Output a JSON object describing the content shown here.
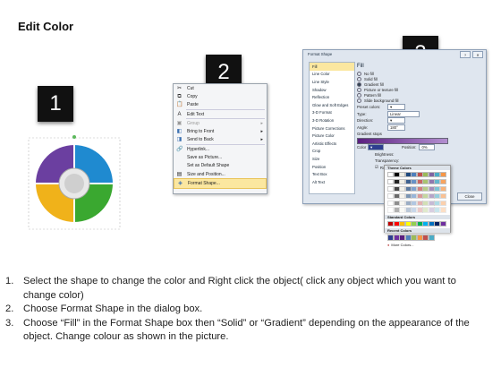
{
  "page": {
    "title": "Edit Color"
  },
  "badges": [
    "1",
    "2",
    "3"
  ],
  "context_menu": {
    "items": [
      {
        "icon": "cut-icon",
        "label": "Cut"
      },
      {
        "icon": "copy-icon",
        "label": "Copy"
      },
      {
        "icon": "paste-icon",
        "label": "Paste"
      },
      {
        "icon": "edit-text-icon",
        "label": "Edit Text"
      },
      {
        "icon": "group-icon",
        "label": "Group",
        "disabled": true,
        "submenu": true
      },
      {
        "icon": "bring-front-icon",
        "label": "Bring to Front",
        "submenu": true
      },
      {
        "icon": "send-back-icon",
        "label": "Send to Back",
        "submenu": true
      },
      {
        "icon": "hyperlink-icon",
        "label": "Hyperlink..."
      },
      {
        "icon": "save-picture-icon",
        "label": "Save as Picture..."
      },
      {
        "icon": "",
        "label": "Set as Default Shape"
      },
      {
        "icon": "size-position-icon",
        "label": "Size and Position..."
      },
      {
        "icon": "format-shape-icon",
        "label": "Format Shape...",
        "highlighted": true
      }
    ]
  },
  "dialog": {
    "title": "Format Shape",
    "nav": [
      "Fill",
      "Line Color",
      "Line Style",
      "Shadow",
      "Reflection",
      "Glow and Soft Edges",
      "3-D Format",
      "3-D Rotation",
      "Picture Corrections",
      "Picture Color",
      "Artistic Effects",
      "Crop",
      "Size",
      "Position",
      "Text Box",
      "Alt Text"
    ],
    "pane_heading": "Fill",
    "fill_options": [
      {
        "label": "No fill",
        "on": false
      },
      {
        "label": "Solid fill",
        "on": false
      },
      {
        "label": "Gradient fill",
        "on": true
      },
      {
        "label": "Picture or texture fill",
        "on": false
      },
      {
        "label": "Pattern fill",
        "on": false
      },
      {
        "label": "Slide background fill",
        "on": false
      }
    ],
    "fields": [
      {
        "key": "Preset colors:",
        "value": ""
      },
      {
        "key": "Type:",
        "value": "Linear"
      },
      {
        "key": "Direction:",
        "value": ""
      },
      {
        "key": "Angle:",
        "value": "180°"
      }
    ],
    "gradient_stops_label": "Gradient stops",
    "color_label": "Color",
    "position_label": "Position:",
    "position_value": "0%",
    "brightness_label": "Brightness:",
    "transparency_label": "Transparency:",
    "rotate_label": "Rotate with shape",
    "close_label": "Close"
  },
  "palette": {
    "theme_label": "Theme Colors",
    "standard_label": "Standard Colors",
    "recent_label": "Recent Colors",
    "more_label": "More Colors...",
    "theme_colors": [
      "#ffffff",
      "#000000",
      "#eeece1",
      "#1f497d",
      "#4f81bd",
      "#c0504d",
      "#9bbb59",
      "#8064a2",
      "#4bacc6",
      "#f79646"
    ],
    "standard_colors": [
      "#c00000",
      "#ff0000",
      "#ffc000",
      "#ffff00",
      "#92d050",
      "#00b050",
      "#00b0f0",
      "#0070c0",
      "#002060",
      "#7030a0"
    ],
    "recent_colors": [
      "#2e3f8f",
      "#7030a0",
      "#5b1f80",
      "#4f81bd",
      "#9bbb59",
      "#f79646",
      "#c0504d",
      "#4bacc6"
    ]
  },
  "steps": [
    {
      "n": "1.",
      "text": "Select the shape to change the color and Right click the object( click any object which you want to change color)"
    },
    {
      "n": "2.",
      "text": "Choose Format Shape in the dialog box."
    },
    {
      "n": "3.",
      "text": "Choose “Fill” in the Format Shape box then “Solid” or “Gradient” depending on the appearance of the object. Change colour as shown in the picture."
    }
  ]
}
